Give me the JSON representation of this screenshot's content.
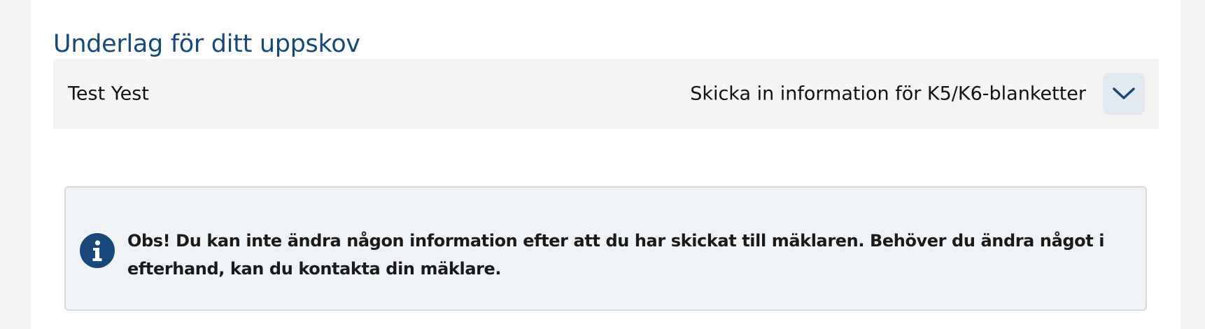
{
  "section": {
    "title": "Underlag för ditt uppskov"
  },
  "accordion": {
    "name": "Test Yest",
    "action_label": "Skicka in information för K5/K6-blanketter",
    "expand_icon": "chevron-down-icon"
  },
  "notice": {
    "icon": "info-icon",
    "text": "Obs! Du kan inte ändra någon information efter att du har skickat till mäklaren. Behöver du ändra något i efterhand, kan du kontakta din mäklare."
  },
  "colors": {
    "brand_blue": "#16497a",
    "row_background": "#f4f4f4",
    "button_background": "#e2e9f1",
    "notice_background": "#f0f3f6"
  }
}
